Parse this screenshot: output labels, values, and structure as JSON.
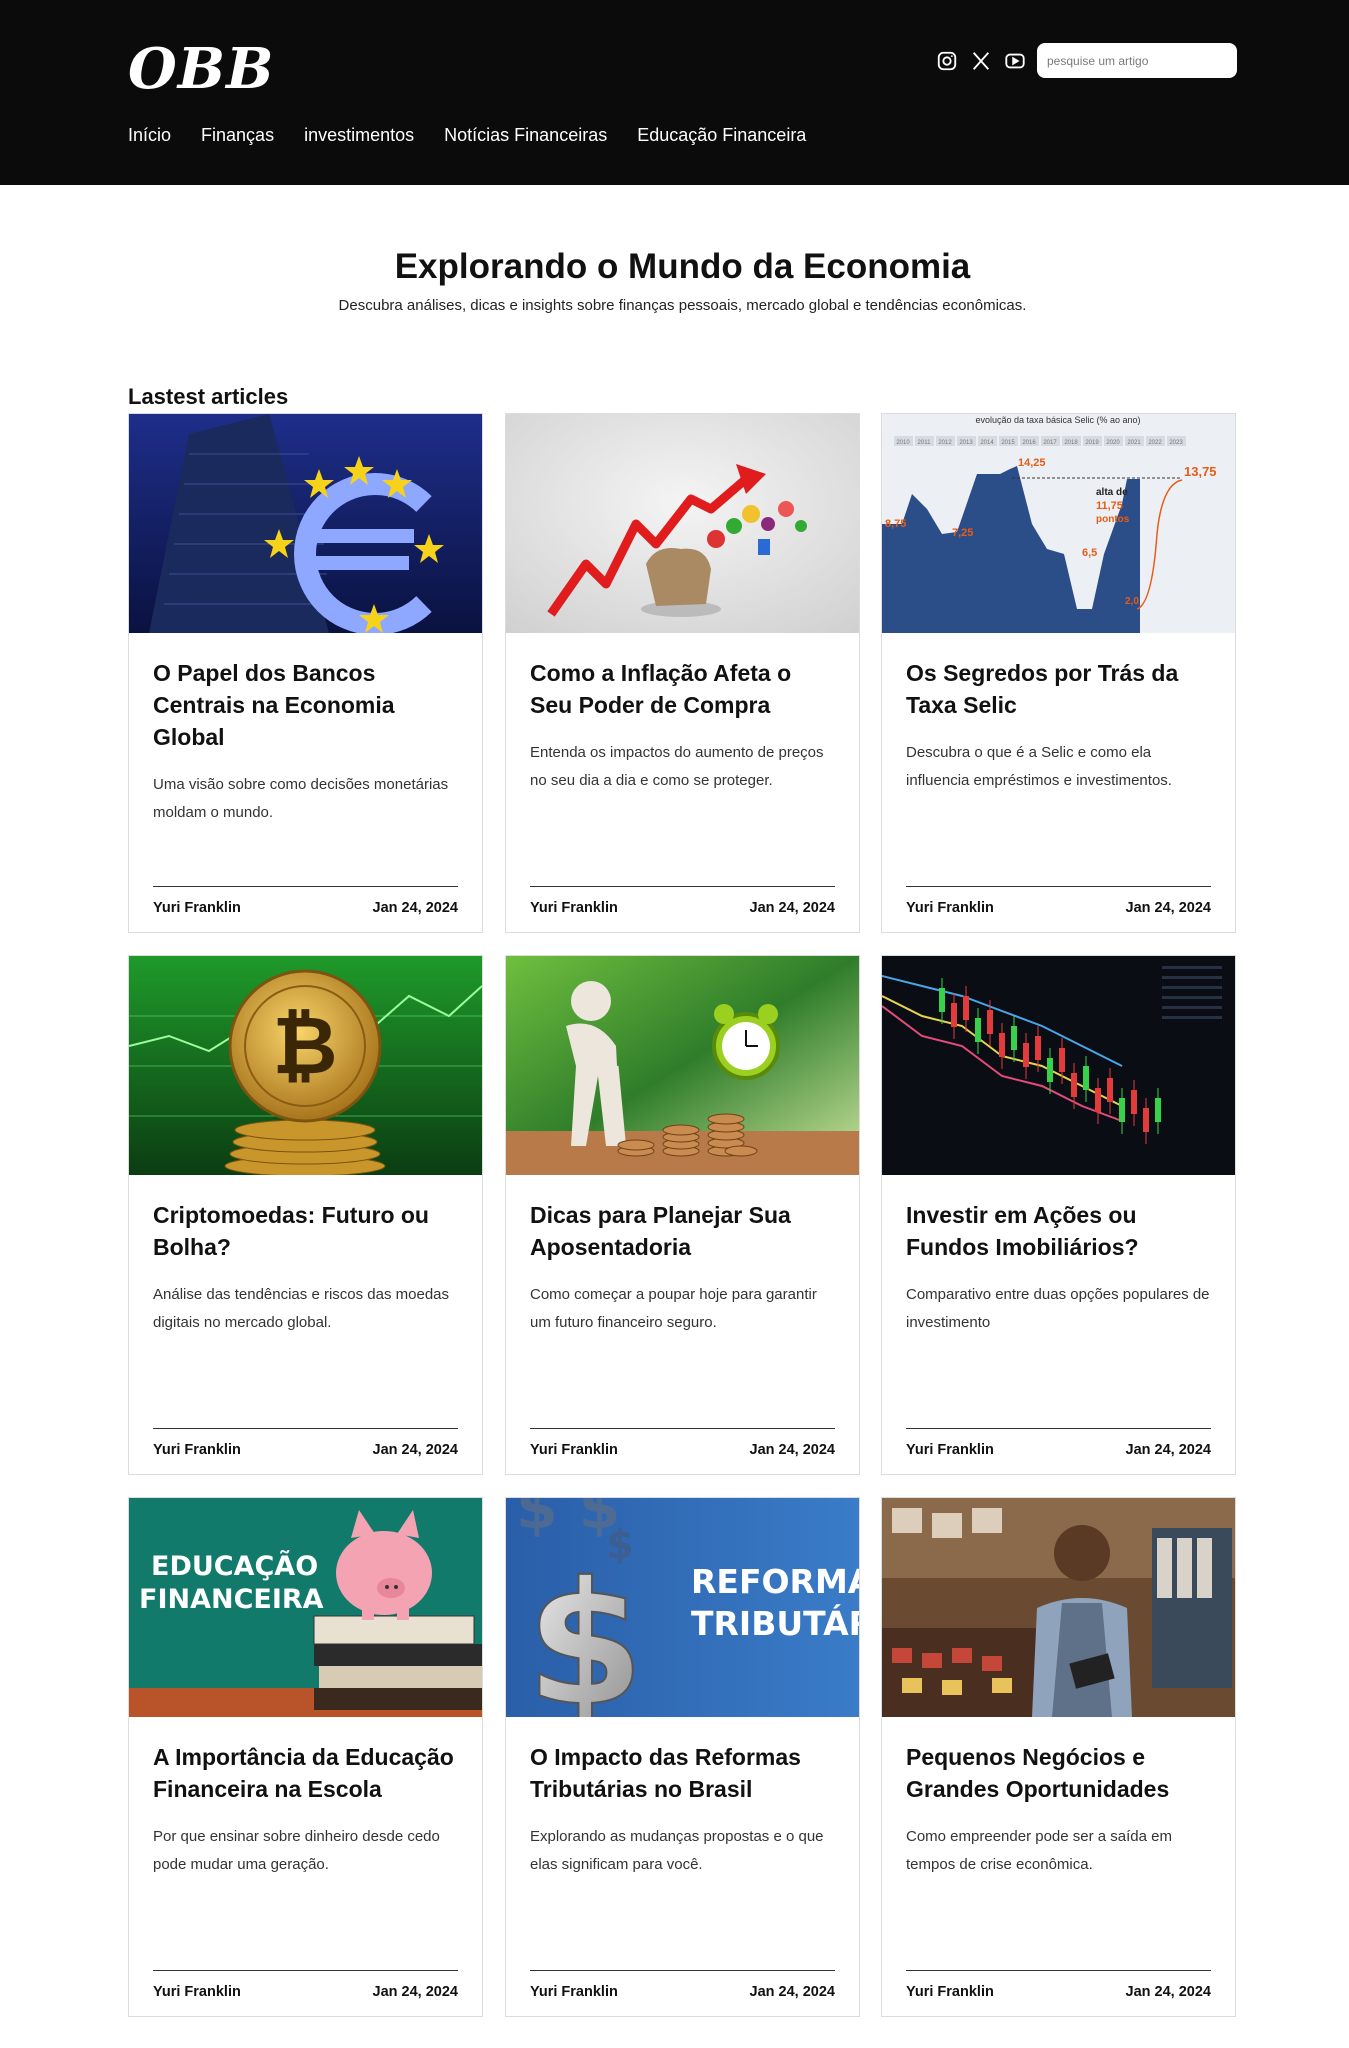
{
  "header": {
    "logo": "OBB",
    "search_placeholder": "pesquise um artigo",
    "social": [
      "instagram-icon",
      "x-icon",
      "youtube-icon"
    ],
    "nav": [
      "Início",
      "Finanças",
      "investimentos",
      "Notícias Financeiras",
      "Educação Financeira"
    ]
  },
  "hero": {
    "title": "Explorando o Mundo da Economia",
    "subtitle": "Descubra análises, dicas e insights sobre finanças pessoais, mercado global e tendências econômicas."
  },
  "section_title": "Lastest articles",
  "articles": [
    {
      "title": "O Papel dos Bancos Centrais na Economia Global",
      "desc": "Uma visão sobre como decisões monetárias moldam o mundo.",
      "author": "Yuri Franklin",
      "date": "Jan 24, 2024"
    },
    {
      "title": "Como a Inflação Afeta o Seu Poder de Compra",
      "desc": "Entenda os impactos do aumento de preços no seu dia a dia e como se proteger.",
      "author": "Yuri Franklin",
      "date": "Jan 24, 2024"
    },
    {
      "title": "Os Segredos por Trás da Taxa Selic",
      "desc": "Descubra o que é a Selic e como ela influencia empréstimos e investimentos.",
      "author": "Yuri Franklin",
      "date": "Jan 24, 2024"
    },
    {
      "title": "Criptomoedas: Futuro ou Bolha?",
      "desc": "Análise das tendências e riscos das moedas digitais no mercado global.",
      "author": "Yuri Franklin",
      "date": "Jan 24, 2024"
    },
    {
      "title": "Dicas para Planejar Sua Aposentadoria",
      "desc": "Como começar a poupar hoje para garantir um futuro financeiro seguro.",
      "author": "Yuri Franklin",
      "date": "Jan 24, 2024"
    },
    {
      "title": "Investir em Ações ou Fundos Imobiliários?",
      "desc": "Comparativo entre duas opções populares de investimento",
      "author": "Yuri Franklin",
      "date": "Jan 24, 2024"
    },
    {
      "title": "A Importância da Educação Financeira na Escola",
      "desc": "Por que ensinar sobre dinheiro desde cedo pode mudar uma geração.",
      "author": "Yuri Franklin",
      "date": "Jan 24, 2024"
    },
    {
      "title": "O Impacto das Reformas Tributárias no Brasil",
      "desc": "Explorando as mudanças propostas e o que elas significam para você.",
      "author": "Yuri Franklin",
      "date": "Jan 24, 2024"
    },
    {
      "title": "Pequenos Negócios e Grandes Oportunidades",
      "desc": "Como empreender pode ser a saída em tempos de crise econômica.",
      "author": "Yuri Franklin",
      "date": "Jan 24, 2024"
    }
  ],
  "images": {
    "selic": {
      "title": "evolução da taxa básica Selic (% ao ano)",
      "years": [
        "2010",
        "2011",
        "2012",
        "2013",
        "2014",
        "2015",
        "2016",
        "2017",
        "2018",
        "2019",
        "2020",
        "2021",
        "2022",
        "2023"
      ],
      "labels": [
        "8,75",
        "7,25",
        "14,25",
        "6,5",
        "2,0",
        "13,75",
        "alta de",
        "11,75",
        "pontos"
      ]
    },
    "edu_text": [
      "EDUCAÇÃO",
      "FINANCEIRA"
    ],
    "reforma_text": [
      "REFORMA",
      "TRIBUTÁRI"
    ]
  }
}
